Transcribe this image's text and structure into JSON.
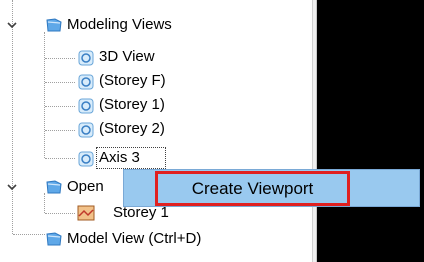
{
  "tree": {
    "items": [
      {
        "label": "Modeling Views",
        "icon": "folder-view-icon",
        "expanded": true
      },
      {
        "label": "3D View",
        "icon": "view-icon"
      },
      {
        "label": "(Storey F)",
        "icon": "view-icon"
      },
      {
        "label": "(Storey 1)",
        "icon": "view-icon"
      },
      {
        "label": "(Storey 2)",
        "icon": "view-icon"
      },
      {
        "label": "Axis 3",
        "icon": "view-icon",
        "selected": true
      },
      {
        "label": "Open",
        "icon": "folder-view-icon",
        "expanded": true
      },
      {
        "label": "Storey 1",
        "icon": "drawing-icon"
      },
      {
        "label": "Model View (Ctrl+D)",
        "icon": "folder-view-icon"
      }
    ]
  },
  "context_menu": {
    "create_viewport": "Create Viewport"
  },
  "colors": {
    "menu_highlight": "#99c9ef",
    "callout_border": "#e02020",
    "dark_pane": "#000000"
  }
}
